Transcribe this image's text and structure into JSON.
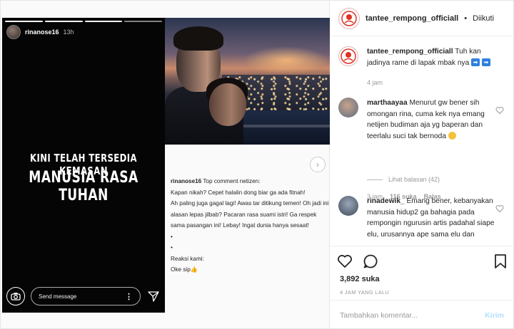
{
  "story": {
    "username": "rinanose16",
    "time": "13h",
    "line1": "KINI TELAH TERSEDIA KEMASAN",
    "line2": "MANUSIA RASA TUHAN",
    "message_placeholder": "Send message",
    "more_label": "⋮"
  },
  "caption": {
    "username": "rinanose16",
    "text": " Top comment netizen:\nKapan nikah? Cepet halalin dong biar ga ada fitnah!\nAh paling juga gagal lagi! Awas tar ditikung temen! Oh jadi ini alasan lepas jilbab? Pacaran rasa suami istri! Ga respek sama pasangan ini! Lebay! Ingat dunia hanya sesaat!\n•\n•\nReaksi kami:\nOke sip👍"
  },
  "header": {
    "username": "tantee_rempong_officiall",
    "separator": "•",
    "follow_label": "Diikuti"
  },
  "comments": [
    {
      "username": "tantee_rempong_officiall",
      "text": " Tuh kan jadinya rame di lapak mbak nya ",
      "time": "4 jam"
    },
    {
      "username": "marthaayaa",
      "text": " Menurut gw bener sih omongan rina, cuma kek nya emang netijen budiman aja yg baperan dan teerlalu suci tak bernoda ",
      "time": "3 jam",
      "likes": "116 suka",
      "reply_label": "Balas"
    },
    {
      "username": "rinadewik_",
      "text": " Emang bener, kebanyakan manusia hidup2 ga bahagia pada rempongin ngurusin artis  padahal siape elu, urusannya ape sama elu dan"
    }
  ],
  "more_replies_label": "Lihat balasan (42)",
  "post": {
    "likes": "3,892 suka",
    "time": "4 JAM YANG LALU"
  },
  "add_comment": {
    "placeholder": "Tambahkan komentar...",
    "post_label": "Kirim"
  },
  "colors": {
    "link_blue": "#b2dffc",
    "muted": "#999999",
    "text": "#262626"
  }
}
